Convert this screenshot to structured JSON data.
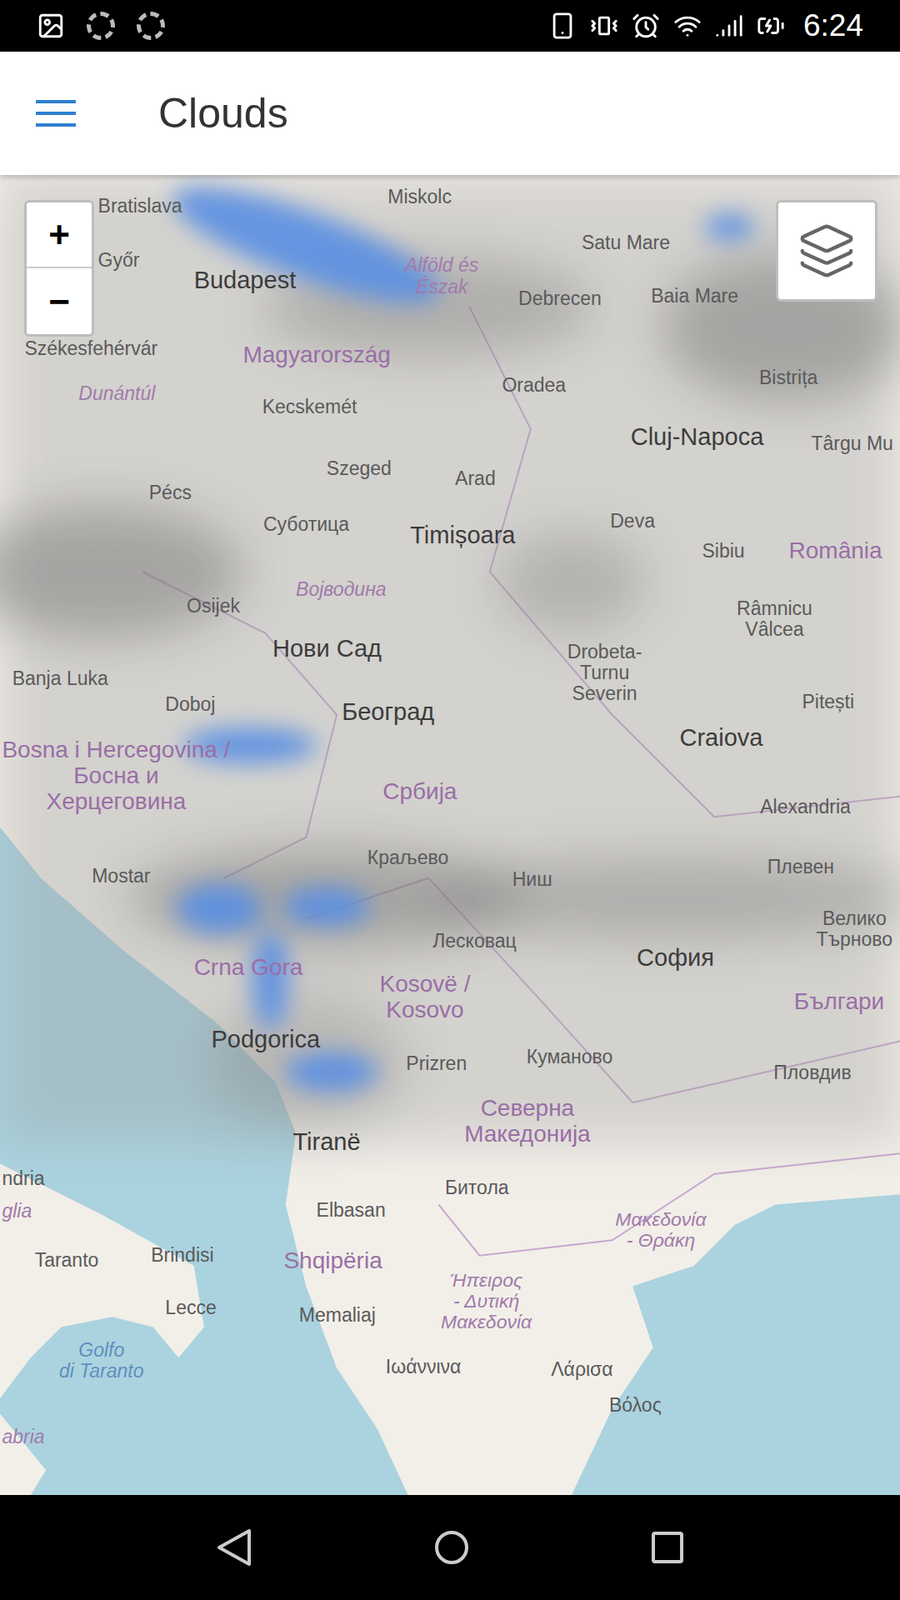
{
  "status_bar": {
    "time": "6:24"
  },
  "app_bar": {
    "title": "Clouds"
  },
  "map": {
    "zoom": [
      "+",
      "−"
    ],
    "labels": [
      {
        "text": "Bratislava",
        "kind": "city"
      },
      {
        "text": "Győr",
        "kind": "city"
      },
      {
        "text": "Miskolc",
        "kind": "city"
      },
      {
        "text": "Satu Mare",
        "kind": "city"
      },
      {
        "text": "Budapest",
        "kind": "major"
      },
      {
        "text": "Alföld és\nÉszak",
        "kind": "region"
      },
      {
        "text": "Debrecen",
        "kind": "city"
      },
      {
        "text": "Baia Mare",
        "kind": "city"
      },
      {
        "text": "Székesfehérvár",
        "kind": "city"
      },
      {
        "text": "Magyarország",
        "kind": "country"
      },
      {
        "text": "Dunántúl",
        "kind": "region"
      },
      {
        "text": "Oradea",
        "kind": "city"
      },
      {
        "text": "Bistrița",
        "kind": "city"
      },
      {
        "text": "Kecskemét",
        "kind": "city"
      },
      {
        "text": "Cluj-Napoca",
        "kind": "major"
      },
      {
        "text": "Târgu Mu",
        "kind": "city"
      },
      {
        "text": "Szeged",
        "kind": "city"
      },
      {
        "text": "Arad",
        "kind": "city"
      },
      {
        "text": "Pécs",
        "kind": "city"
      },
      {
        "text": "Суботица",
        "kind": "city"
      },
      {
        "text": "Timișoara",
        "kind": "major"
      },
      {
        "text": "Deva",
        "kind": "city"
      },
      {
        "text": "Sibiu",
        "kind": "city"
      },
      {
        "text": "România",
        "kind": "country"
      },
      {
        "text": "Војводина",
        "kind": "region"
      },
      {
        "text": "Osijek",
        "kind": "city"
      },
      {
        "text": "Râmnicu\nVâlcea",
        "kind": "city"
      },
      {
        "text": "Нови Сад",
        "kind": "major"
      },
      {
        "text": "Drobeta-\nTurnu\nSeverin",
        "kind": "city"
      },
      {
        "text": "Pitești",
        "kind": "city"
      },
      {
        "text": "Banja Luka",
        "kind": "city"
      },
      {
        "text": "Doboj",
        "kind": "city"
      },
      {
        "text": "Београд",
        "kind": "major"
      },
      {
        "text": "Craiova",
        "kind": "major"
      },
      {
        "text": "Bosna i Hercegovina /\nБосна и\nХерцеговина",
        "kind": "country"
      },
      {
        "text": "Србија",
        "kind": "country"
      },
      {
        "text": "Alexandria",
        "kind": "city"
      },
      {
        "text": "Mostar",
        "kind": "city"
      },
      {
        "text": "Краљево",
        "kind": "city"
      },
      {
        "text": "Ниш",
        "kind": "city"
      },
      {
        "text": "Плевен",
        "kind": "city"
      },
      {
        "text": "Велико\nТърново",
        "kind": "city"
      },
      {
        "text": "Лесковац",
        "kind": "city"
      },
      {
        "text": "Crna Gora",
        "kind": "country"
      },
      {
        "text": "Kosovë /\nKosovo",
        "kind": "country"
      },
      {
        "text": "София",
        "kind": "major"
      },
      {
        "text": "Българи",
        "kind": "country"
      },
      {
        "text": "Podgorica",
        "kind": "major"
      },
      {
        "text": "Prizren",
        "kind": "city"
      },
      {
        "text": "Куманово",
        "kind": "city"
      },
      {
        "text": "Пловдив",
        "kind": "city"
      },
      {
        "text": "Северна\nМакедонија",
        "kind": "country"
      },
      {
        "text": "Tiranë",
        "kind": "major"
      },
      {
        "text": "Битола",
        "kind": "city"
      },
      {
        "text": "Elbasan",
        "kind": "city"
      },
      {
        "text": "Μακεδονία\n- Θράκη",
        "kind": "region"
      },
      {
        "text": "Shqipëria",
        "kind": "country"
      },
      {
        "text": "Ήπειρος\n- Δυτική\nΜακεδονία",
        "kind": "region"
      },
      {
        "text": "Taranto",
        "kind": "city"
      },
      {
        "text": "Brindisi",
        "kind": "city"
      },
      {
        "text": "Lecce",
        "kind": "city"
      },
      {
        "text": "Memaliaj",
        "kind": "city"
      },
      {
        "text": "Golfo\ndi Taranto",
        "kind": "water"
      },
      {
        "text": "Ιωάννινα",
        "kind": "city"
      },
      {
        "text": "Λάρισα",
        "kind": "city"
      },
      {
        "text": "Βόλος",
        "kind": "city"
      },
      {
        "text": "ndria",
        "kind": "city"
      },
      {
        "text": "glia",
        "kind": "region"
      },
      {
        "text": "abria",
        "kind": "region"
      }
    ]
  }
}
